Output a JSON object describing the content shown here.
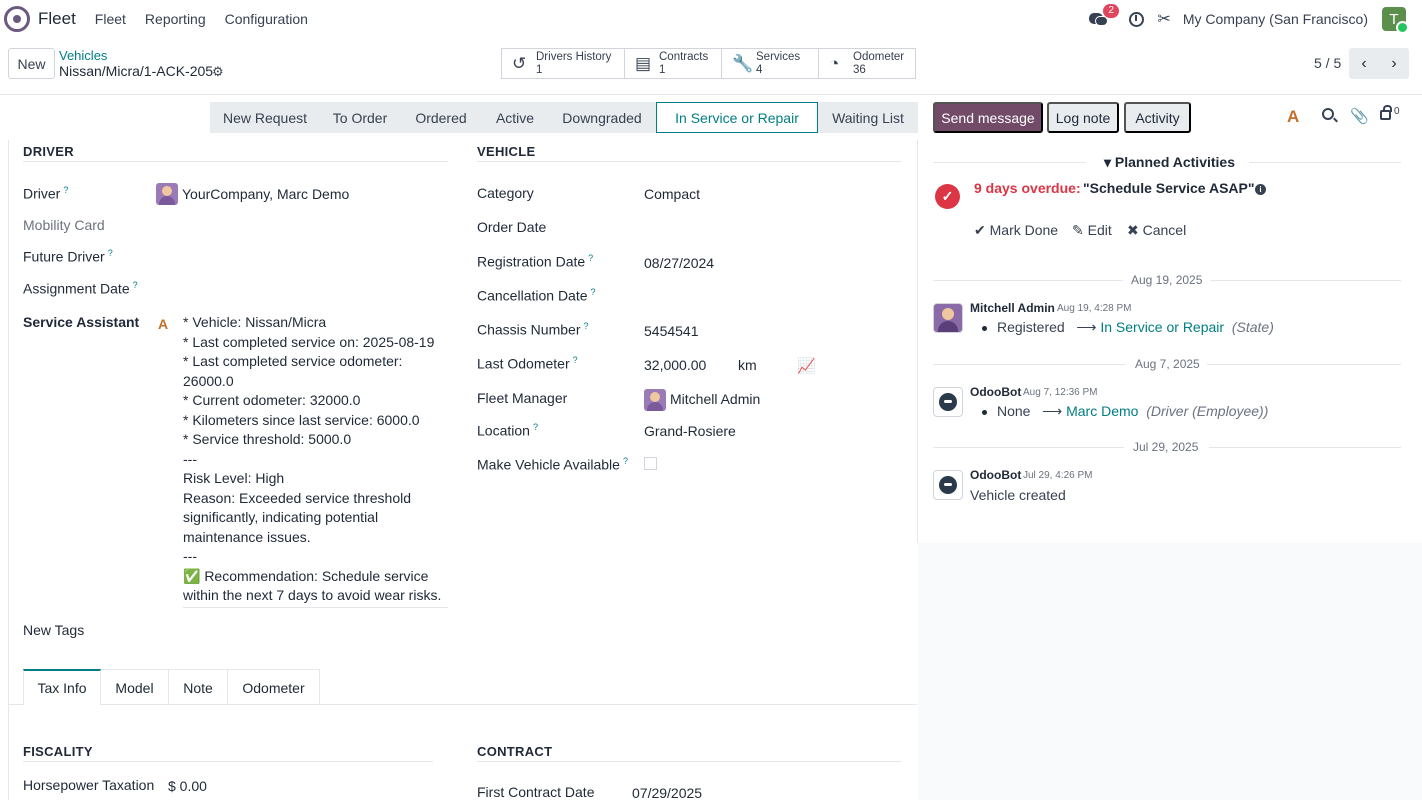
{
  "navbar": {
    "app_name": "Fleet",
    "menus": [
      "Fleet",
      "Reporting",
      "Configuration"
    ],
    "messages_badge": "2",
    "company": "My Company (San Francisco)",
    "user_initial": "T"
  },
  "control": {
    "new_label": "New",
    "breadcrumb_parent": "Vehicles",
    "breadcrumb_current": "Nissan/Micra/1-ACK-205",
    "pager": "5 / 5"
  },
  "smart_buttons": [
    {
      "label": "Drivers History",
      "value": "1",
      "icon": "history-icon"
    },
    {
      "label": "Contracts",
      "value": "1",
      "icon": "book-icon"
    },
    {
      "label": "Services",
      "value": "4",
      "icon": "wrench-icon"
    },
    {
      "label": "Odometer",
      "value": "36",
      "icon": "tachometer-icon"
    }
  ],
  "statusbar": {
    "stages": [
      "New Request",
      "To Order",
      "Ordered",
      "Active",
      "Downgraded",
      "In Service or Repair",
      "Waiting List"
    ],
    "active_index": 5
  },
  "chatter_buttons": {
    "send": "Send message",
    "log": "Log note",
    "activity": "Activity",
    "followers": "0"
  },
  "driver_section": {
    "title": "DRIVER",
    "driver_label": "Driver",
    "driver_value": "YourCompany, Marc Demo",
    "mobility_label": "Mobility Card",
    "future_driver_label": "Future Driver",
    "assignment_label": "Assignment Date",
    "assistant_label": "Service Assistant",
    "assistant_lines": [
      "* Vehicle: Nissan/Micra",
      "* Last completed service on: 2025-08-19",
      "* Last completed service odometer:",
      "26000.0",
      "* Current odometer: 32000.0",
      "* Kilometers since last service: 6000.0",
      "* Service threshold: 5000.0",
      "---",
      "Risk Level: High",
      "Reason: Exceeded service threshold",
      "significantly, indicating potential",
      "maintenance issues.",
      "---",
      "✅ Recommendation: Schedule service",
      "within the next 7 days to avoid wear risks."
    ],
    "tags_label": "New Tags"
  },
  "vehicle_section": {
    "title": "VEHICLE",
    "category_label": "Category",
    "category_value": "Compact",
    "order_date_label": "Order Date",
    "registration_label": "Registration Date",
    "registration_value": "08/27/2024",
    "cancellation_label": "Cancellation Date",
    "chassis_label": "Chassis Number",
    "chassis_value": "5454541",
    "odometer_label": "Last Odometer",
    "odometer_value": "32,000.00",
    "odometer_unit": "km",
    "manager_label": "Fleet Manager",
    "manager_value": "Mitchell Admin",
    "location_label": "Location",
    "location_value": "Grand-Rosiere",
    "available_label": "Make Vehicle Available"
  },
  "tabs": [
    "Tax Info",
    "Model",
    "Note",
    "Odometer"
  ],
  "fiscality": {
    "title": "FISCALITY",
    "horsepower_label": "Horsepower Taxation",
    "horsepower_value": "$ 0.00"
  },
  "contract": {
    "title": "CONTRACT",
    "first_date_label": "First Contract Date",
    "first_date_value": "07/29/2025"
  },
  "chatter": {
    "planned_title": "Planned Activities",
    "overdue": "9 days overdue:",
    "activity_summary": "\"Schedule Service ASAP\"",
    "mark_done": "Mark Done",
    "edit": "Edit",
    "cancel": "Cancel",
    "messages": [
      {
        "date_sep": "Aug 19, 2025",
        "author": "Mitchell Admin",
        "date": "Aug 19, 4:28 PM",
        "old": "Registered",
        "new": "In Service or Repair",
        "field": "(State)"
      },
      {
        "date_sep": "Aug 7, 2025",
        "author": "OdooBot",
        "date": "Aug 7, 12:36 PM",
        "old": "None",
        "new": "Marc Demo",
        "field": "(Driver (Employee))"
      },
      {
        "date_sep": "Jul 29, 2025",
        "author": "OdooBot",
        "date": "Jul 29, 4:26 PM",
        "body": "Vehicle created"
      }
    ]
  }
}
